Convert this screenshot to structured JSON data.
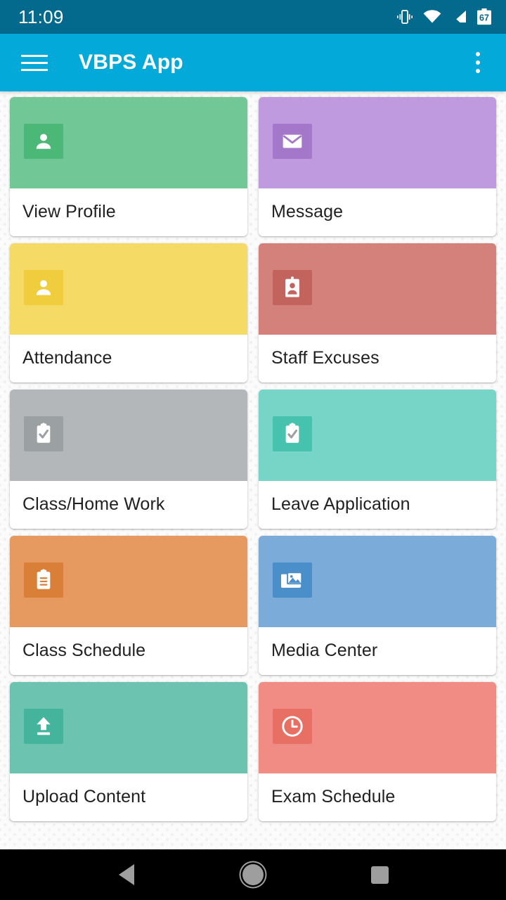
{
  "status_bar": {
    "time": "11:09",
    "battery_level": "67",
    "icons": [
      "vibrate-icon",
      "wifi-icon",
      "cellular-signal-icon",
      "battery-icon"
    ]
  },
  "app_bar": {
    "title": "VBPS App",
    "menu_icon": "hamburger-menu-icon",
    "overflow_icon": "overflow-menu-icon"
  },
  "grid": {
    "items": [
      {
        "label": "View Profile",
        "icon": "person-icon",
        "banner_color": "#71c795",
        "icon_bg_color": "#4cb878"
      },
      {
        "label": "Message",
        "icon": "envelope-icon",
        "banner_color": "#c09ade",
        "icon_bg_color": "#a577cb"
      },
      {
        "label": "Attendance",
        "icon": "person-icon",
        "banner_color": "#f5da66",
        "icon_bg_color": "#efcd3c"
      },
      {
        "label": "Staff Excuses",
        "icon": "id-badge-icon",
        "banner_color": "#d4807b",
        "icon_bg_color": "#c2635e"
      },
      {
        "label": "Class/Home Work",
        "icon": "clipboard-check-icon",
        "banner_color": "#b3b7ba",
        "icon_bg_color": "#9ba0a3"
      },
      {
        "label": "Leave Application",
        "icon": "clipboard-check-icon",
        "banner_color": "#76d5c6",
        "icon_bg_color": "#47c2ae"
      },
      {
        "label": "Class Schedule",
        "icon": "clipboard-lines-icon",
        "banner_color": "#e79a5f",
        "icon_bg_color": "#d97f38"
      },
      {
        "label": "Media Center",
        "icon": "photo-library-icon",
        "banner_color": "#7bacd9",
        "icon_bg_color": "#4a8fc9"
      },
      {
        "label": "Upload Content",
        "icon": "upload-arrow-icon",
        "banner_color": "#6cc3b0",
        "icon_bg_color": "#45b49c"
      },
      {
        "label": "Exam Schedule",
        "icon": "clock-icon",
        "banner_color": "#f08c83",
        "icon_bg_color": "#e86f64"
      }
    ]
  },
  "nav_bar": {
    "back_label": "Back",
    "home_label": "Home",
    "recents_label": "Recents"
  },
  "colors": {
    "status_bar": "#046a8d",
    "app_bar": "#03a9d8",
    "card_surface": "#ffffff",
    "page_background": "#fbfbfb",
    "text_primary": "#212121",
    "nav_bar": "#000000"
  }
}
